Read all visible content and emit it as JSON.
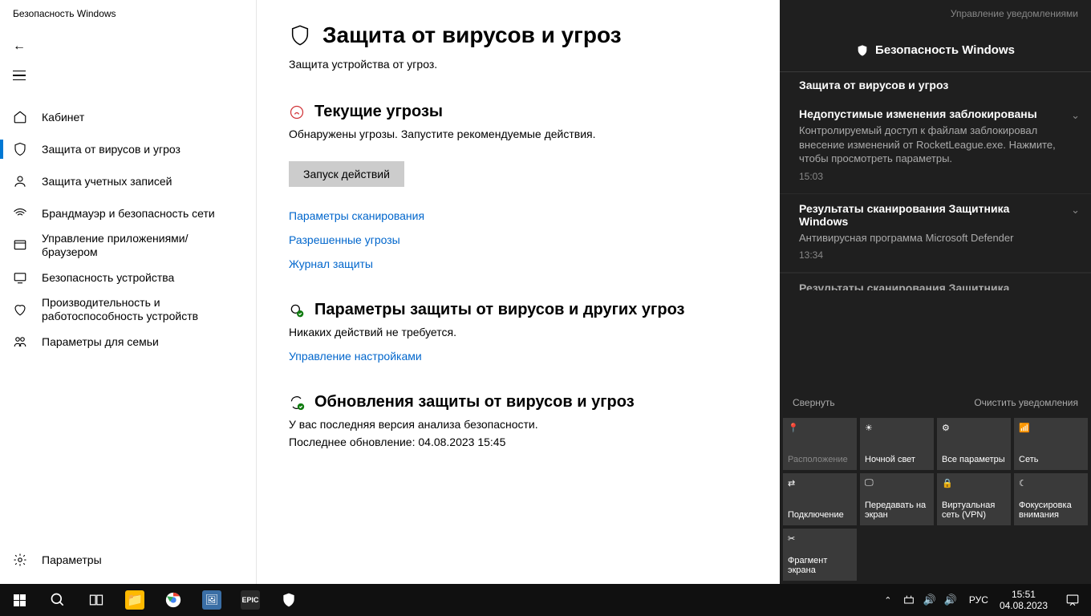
{
  "app_title": "Безопасность Windows",
  "sidebar": {
    "items": [
      {
        "label": "Кабинет"
      },
      {
        "label": "Защита от вирусов и угроз"
      },
      {
        "label": "Защита учетных записей"
      },
      {
        "label": "Брандмауэр и безопасность сети"
      },
      {
        "label": "Управление приложениями/браузером"
      },
      {
        "label": "Безопасность устройства"
      },
      {
        "label": "Производительность и работоспособность устройств"
      },
      {
        "label": "Параметры для семьи"
      }
    ],
    "settings_label": "Параметры"
  },
  "main": {
    "title": "Защита от вирусов и угроз",
    "subtitle": "Защита устройства от угроз.",
    "threats": {
      "heading": "Текущие угрозы",
      "body": "Обнаружены угрозы. Запустите рекомендуемые действия.",
      "button": "Запуск действий",
      "links": [
        "Параметры сканирования",
        "Разрешенные угрозы",
        "Журнал защиты"
      ]
    },
    "protection": {
      "heading": "Параметры защиты от вирусов и других угроз",
      "body": "Никаких действий не требуется.",
      "link": "Управление настройками"
    },
    "updates": {
      "heading": "Обновления защиты от вирусов и угроз",
      "body": "У вас последняя версия анализа безопасности.",
      "meta": "Последнее обновление: 04.08.2023 15:45"
    }
  },
  "action_center": {
    "manage": "Управление уведомлениями",
    "title": "Безопасность Windows",
    "group": "Защита от вирусов и угроз",
    "notifications": [
      {
        "title": "Недопустимые изменения заблокированы",
        "body": "Контролируемый доступ к файлам заблокировал внесение изменений от RocketLeague.exe. Нажмите, чтобы просмотреть параметры.",
        "time": "15:03"
      },
      {
        "title": "Результаты сканирования Защитника Windows",
        "body": "Антивирусная программа Microsoft Defender",
        "time": "13:34"
      }
    ],
    "partial": "Результаты сканирования Защитника",
    "collapse": "Свернуть",
    "clear": "Очистить уведомления",
    "tiles": [
      {
        "label": "Расположение",
        "disabled": true
      },
      {
        "label": "Ночной свет"
      },
      {
        "label": "Все параметры"
      },
      {
        "label": "Сеть"
      },
      {
        "label": "Подключение"
      },
      {
        "label": "Передавать на экран"
      },
      {
        "label": "Виртуальная сеть (VPN)"
      },
      {
        "label": "Фокусировка внимания"
      },
      {
        "label": "Фрагмент экрана"
      }
    ]
  },
  "taskbar": {
    "lang": "РУС",
    "time": "15:51",
    "date": "04.08.2023"
  }
}
